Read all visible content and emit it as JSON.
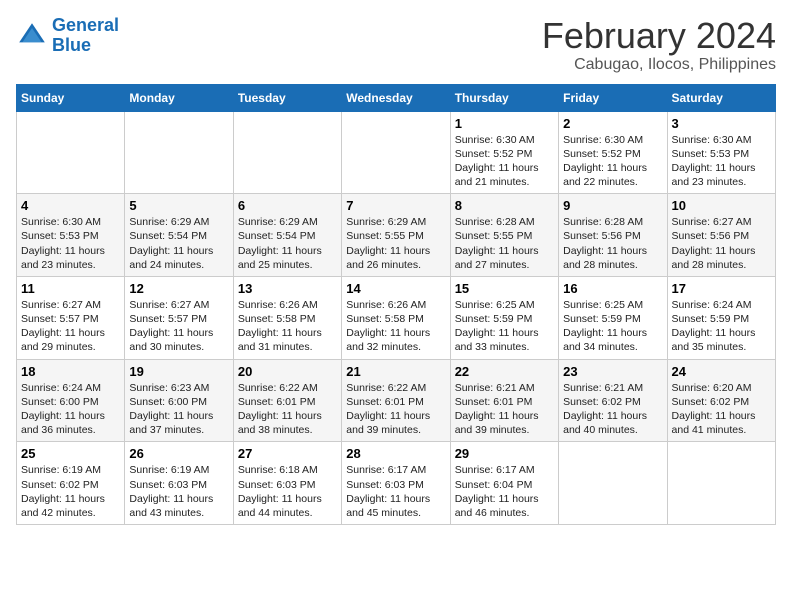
{
  "header": {
    "logo_line1": "General",
    "logo_line2": "Blue",
    "title": "February 2024",
    "subtitle": "Cabugao, Ilocos, Philippines"
  },
  "days_of_week": [
    "Sunday",
    "Monday",
    "Tuesday",
    "Wednesday",
    "Thursday",
    "Friday",
    "Saturday"
  ],
  "weeks": [
    [
      {
        "day": "",
        "empty": true
      },
      {
        "day": "",
        "empty": true
      },
      {
        "day": "",
        "empty": true
      },
      {
        "day": "",
        "empty": true
      },
      {
        "day": "1",
        "sunrise": "6:30 AM",
        "sunset": "5:52 PM",
        "daylight": "11 hours and 21 minutes."
      },
      {
        "day": "2",
        "sunrise": "6:30 AM",
        "sunset": "5:52 PM",
        "daylight": "11 hours and 22 minutes."
      },
      {
        "day": "3",
        "sunrise": "6:30 AM",
        "sunset": "5:53 PM",
        "daylight": "11 hours and 23 minutes."
      }
    ],
    [
      {
        "day": "4",
        "sunrise": "6:30 AM",
        "sunset": "5:53 PM",
        "daylight": "11 hours and 23 minutes."
      },
      {
        "day": "5",
        "sunrise": "6:29 AM",
        "sunset": "5:54 PM",
        "daylight": "11 hours and 24 minutes."
      },
      {
        "day": "6",
        "sunrise": "6:29 AM",
        "sunset": "5:54 PM",
        "daylight": "11 hours and 25 minutes."
      },
      {
        "day": "7",
        "sunrise": "6:29 AM",
        "sunset": "5:55 PM",
        "daylight": "11 hours and 26 minutes."
      },
      {
        "day": "8",
        "sunrise": "6:28 AM",
        "sunset": "5:55 PM",
        "daylight": "11 hours and 27 minutes."
      },
      {
        "day": "9",
        "sunrise": "6:28 AM",
        "sunset": "5:56 PM",
        "daylight": "11 hours and 28 minutes."
      },
      {
        "day": "10",
        "sunrise": "6:27 AM",
        "sunset": "5:56 PM",
        "daylight": "11 hours and 28 minutes."
      }
    ],
    [
      {
        "day": "11",
        "sunrise": "6:27 AM",
        "sunset": "5:57 PM",
        "daylight": "11 hours and 29 minutes."
      },
      {
        "day": "12",
        "sunrise": "6:27 AM",
        "sunset": "5:57 PM",
        "daylight": "11 hours and 30 minutes."
      },
      {
        "day": "13",
        "sunrise": "6:26 AM",
        "sunset": "5:58 PM",
        "daylight": "11 hours and 31 minutes."
      },
      {
        "day": "14",
        "sunrise": "6:26 AM",
        "sunset": "5:58 PM",
        "daylight": "11 hours and 32 minutes."
      },
      {
        "day": "15",
        "sunrise": "6:25 AM",
        "sunset": "5:59 PM",
        "daylight": "11 hours and 33 minutes."
      },
      {
        "day": "16",
        "sunrise": "6:25 AM",
        "sunset": "5:59 PM",
        "daylight": "11 hours and 34 minutes."
      },
      {
        "day": "17",
        "sunrise": "6:24 AM",
        "sunset": "5:59 PM",
        "daylight": "11 hours and 35 minutes."
      }
    ],
    [
      {
        "day": "18",
        "sunrise": "6:24 AM",
        "sunset": "6:00 PM",
        "daylight": "11 hours and 36 minutes."
      },
      {
        "day": "19",
        "sunrise": "6:23 AM",
        "sunset": "6:00 PM",
        "daylight": "11 hours and 37 minutes."
      },
      {
        "day": "20",
        "sunrise": "6:22 AM",
        "sunset": "6:01 PM",
        "daylight": "11 hours and 38 minutes."
      },
      {
        "day": "21",
        "sunrise": "6:22 AM",
        "sunset": "6:01 PM",
        "daylight": "11 hours and 39 minutes."
      },
      {
        "day": "22",
        "sunrise": "6:21 AM",
        "sunset": "6:01 PM",
        "daylight": "11 hours and 39 minutes."
      },
      {
        "day": "23",
        "sunrise": "6:21 AM",
        "sunset": "6:02 PM",
        "daylight": "11 hours and 40 minutes."
      },
      {
        "day": "24",
        "sunrise": "6:20 AM",
        "sunset": "6:02 PM",
        "daylight": "11 hours and 41 minutes."
      }
    ],
    [
      {
        "day": "25",
        "sunrise": "6:19 AM",
        "sunset": "6:02 PM",
        "daylight": "11 hours and 42 minutes."
      },
      {
        "day": "26",
        "sunrise": "6:19 AM",
        "sunset": "6:03 PM",
        "daylight": "11 hours and 43 minutes."
      },
      {
        "day": "27",
        "sunrise": "6:18 AM",
        "sunset": "6:03 PM",
        "daylight": "11 hours and 44 minutes."
      },
      {
        "day": "28",
        "sunrise": "6:17 AM",
        "sunset": "6:03 PM",
        "daylight": "11 hours and 45 minutes."
      },
      {
        "day": "29",
        "sunrise": "6:17 AM",
        "sunset": "6:04 PM",
        "daylight": "11 hours and 46 minutes."
      },
      {
        "day": "",
        "empty": true
      },
      {
        "day": "",
        "empty": true
      }
    ]
  ]
}
